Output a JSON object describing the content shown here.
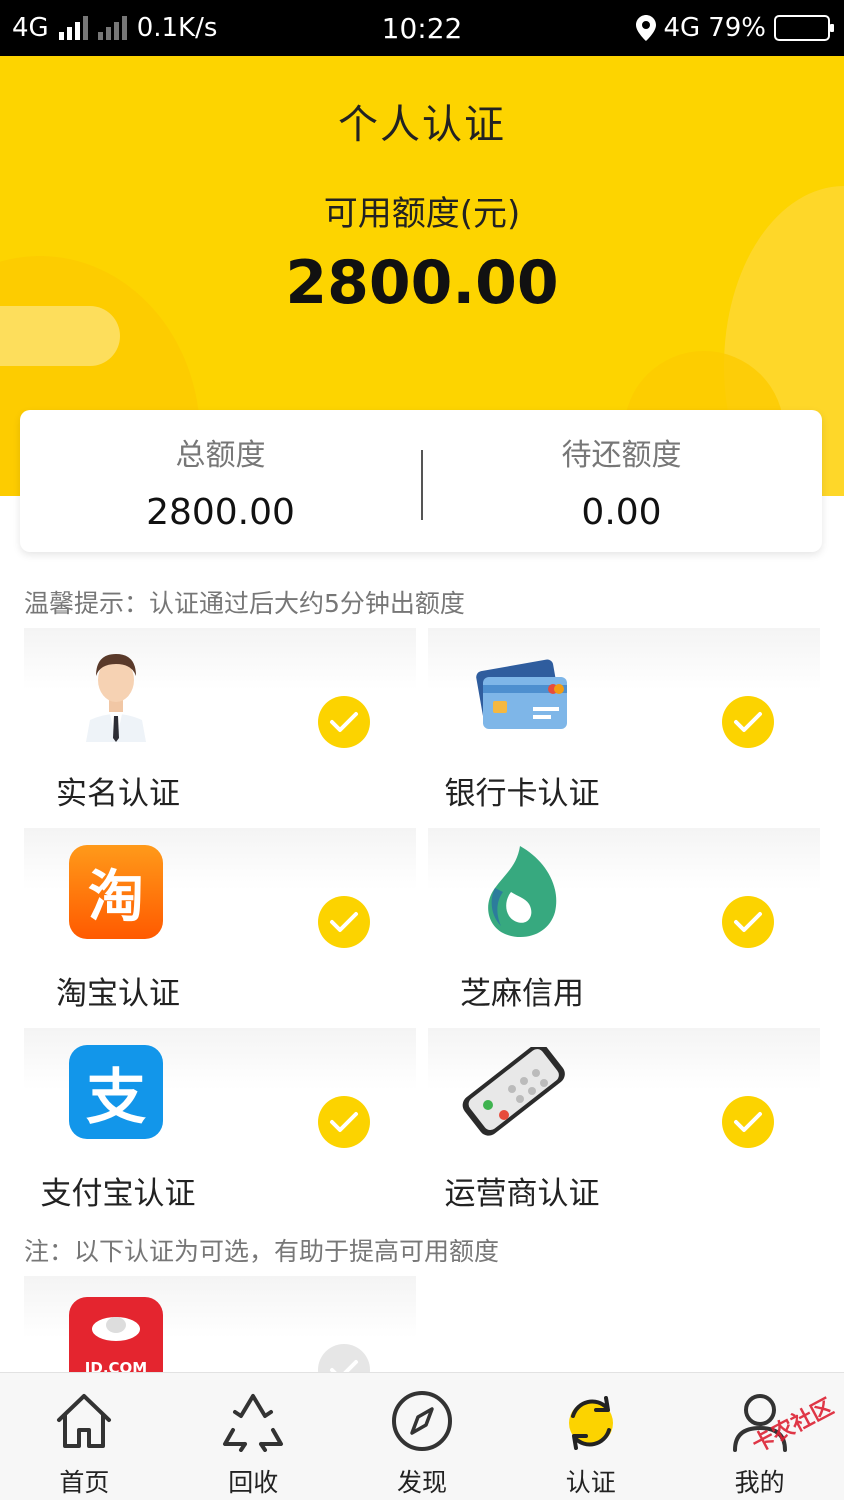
{
  "status_bar": {
    "network_left": "4G",
    "speed": "0.1K/s",
    "time": "10:22",
    "network_right": "4G",
    "battery": "79%"
  },
  "header": {
    "title": "个人认证",
    "available_label": "可用额度(元)",
    "available_value": "2800.00"
  },
  "summary": {
    "total_label": "总额度",
    "total_value": "2800.00",
    "pending_label": "待还额度",
    "pending_value": "0.00"
  },
  "tip": "温馨提示：认证通过后大约5分钟出额度",
  "auth_items": [
    {
      "label": "实名认证",
      "icon": "person-icon",
      "verified": true
    },
    {
      "label": "银行卡认证",
      "icon": "bank-card-icon",
      "verified": true
    },
    {
      "label": "淘宝认证",
      "icon": "taobao-icon",
      "verified": true
    },
    {
      "label": "芝麻信用",
      "icon": "sesame-credit-icon",
      "verified": true
    },
    {
      "label": "支付宝认证",
      "icon": "alipay-icon",
      "verified": true
    },
    {
      "label": "运营商认证",
      "icon": "phone-icon",
      "verified": true
    }
  ],
  "optional_note": "注：以下认证为可选，有助于提高可用额度",
  "optional_items": [
    {
      "icon": "jd-icon",
      "logo_text": "JD.COM",
      "verified": false
    }
  ],
  "taobao_glyph": "淘",
  "alipay_glyph": "支",
  "bottom_nav": [
    {
      "label": "首页",
      "icon": "home-icon"
    },
    {
      "label": "回收",
      "icon": "recycle-icon"
    },
    {
      "label": "发现",
      "icon": "compass-icon"
    },
    {
      "label": "认证",
      "icon": "verify-icon",
      "active": true
    },
    {
      "label": "我的",
      "icon": "profile-icon"
    }
  ],
  "watermark": "卡农社区",
  "colors": {
    "brand_yellow": "#fdd400",
    "check_yellow": "#fcd300"
  }
}
